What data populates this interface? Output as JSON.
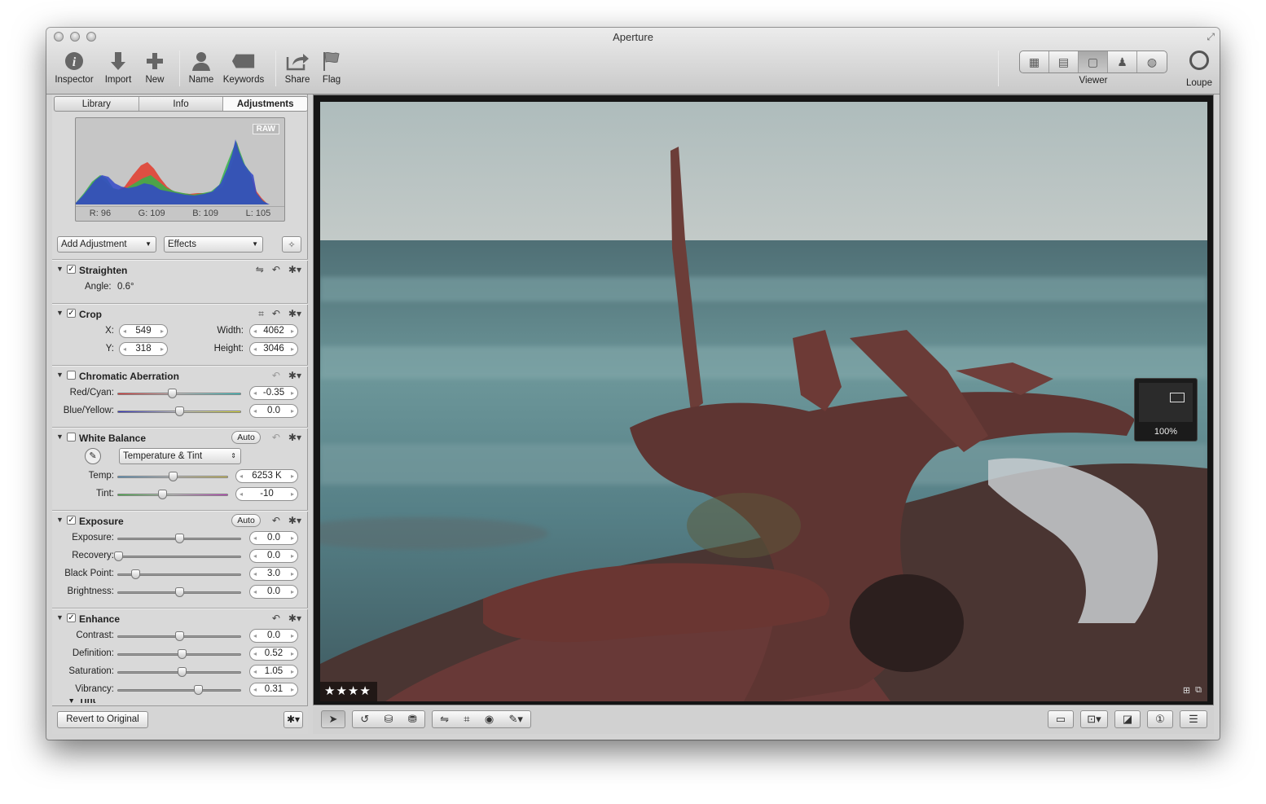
{
  "window": {
    "title": "Aperture"
  },
  "toolbar": {
    "items": [
      {
        "label": "Inspector",
        "icon": "info-icon"
      },
      {
        "label": "Import",
        "icon": "import-arrow-icon"
      },
      {
        "label": "New",
        "icon": "plus-icon"
      },
      {
        "label": "Name",
        "icon": "person-icon"
      },
      {
        "label": "Keywords",
        "icon": "tag-icon"
      },
      {
        "label": "Share",
        "icon": "share-icon"
      },
      {
        "label": "Flag",
        "icon": "flag-icon"
      }
    ],
    "viewer_label": "Viewer",
    "loupe_label": "Loupe"
  },
  "panel": {
    "tabs": [
      "Library",
      "Info",
      "Adjustments"
    ],
    "active_tab": "Adjustments",
    "histogram": {
      "badge": "RAW",
      "r": "R: 96",
      "g": "G: 109",
      "b": "B: 109",
      "l": "L: 105"
    },
    "add_adjustment": "Add Adjustment",
    "effects": "Effects",
    "straighten": {
      "name": "Straighten",
      "enabled": true,
      "angle_label": "Angle:",
      "angle_value": "0.6°"
    },
    "crop": {
      "name": "Crop",
      "enabled": true,
      "x_label": "X:",
      "x": "549",
      "y_label": "Y:",
      "y": "318",
      "width_label": "Width:",
      "width": "4062",
      "height_label": "Height:",
      "height": "3046"
    },
    "chromatic": {
      "name": "Chromatic Aberration",
      "enabled": false,
      "rows": [
        {
          "label": "Red/Cyan:",
          "value": "-0.35",
          "level": 0.44
        },
        {
          "label": "Blue/Yellow:",
          "value": "0.0",
          "level": 0.5
        }
      ]
    },
    "white_balance": {
      "name": "White Balance",
      "enabled": false,
      "auto": "Auto",
      "mode": "Temperature & Tint",
      "rows": [
        {
          "label": "Temp:",
          "value": "6253 K",
          "level": 0.5
        },
        {
          "label": "Tint:",
          "value": "-10",
          "level": 0.4
        }
      ]
    },
    "exposure": {
      "name": "Exposure",
      "enabled": true,
      "auto": "Auto",
      "rows": [
        {
          "label": "Exposure:",
          "value": "0.0",
          "level": 0.5
        },
        {
          "label": "Recovery:",
          "value": "0.0",
          "level": 0.0
        },
        {
          "label": "Black Point:",
          "value": "3.0",
          "level": 0.14
        },
        {
          "label": "Brightness:",
          "value": "0.0",
          "level": 0.5
        }
      ]
    },
    "enhance": {
      "name": "Enhance",
      "enabled": true,
      "rows": [
        {
          "label": "Contrast:",
          "value": "0.0",
          "level": 0.5
        },
        {
          "label": "Definition:",
          "value": "0.52",
          "level": 0.52
        },
        {
          "label": "Saturation:",
          "value": "1.05",
          "level": 0.52
        },
        {
          "label": "Vibrancy:",
          "value": "0.31",
          "level": 0.65
        }
      ]
    },
    "tint_partial": "Tint",
    "revert": "Revert to Original"
  },
  "viewer": {
    "rating": "★★★★",
    "zoom": "100%"
  },
  "colors": {
    "sea": "#5b8a8f",
    "sky": "#b9c6c6",
    "wood": "#6a3a35"
  }
}
